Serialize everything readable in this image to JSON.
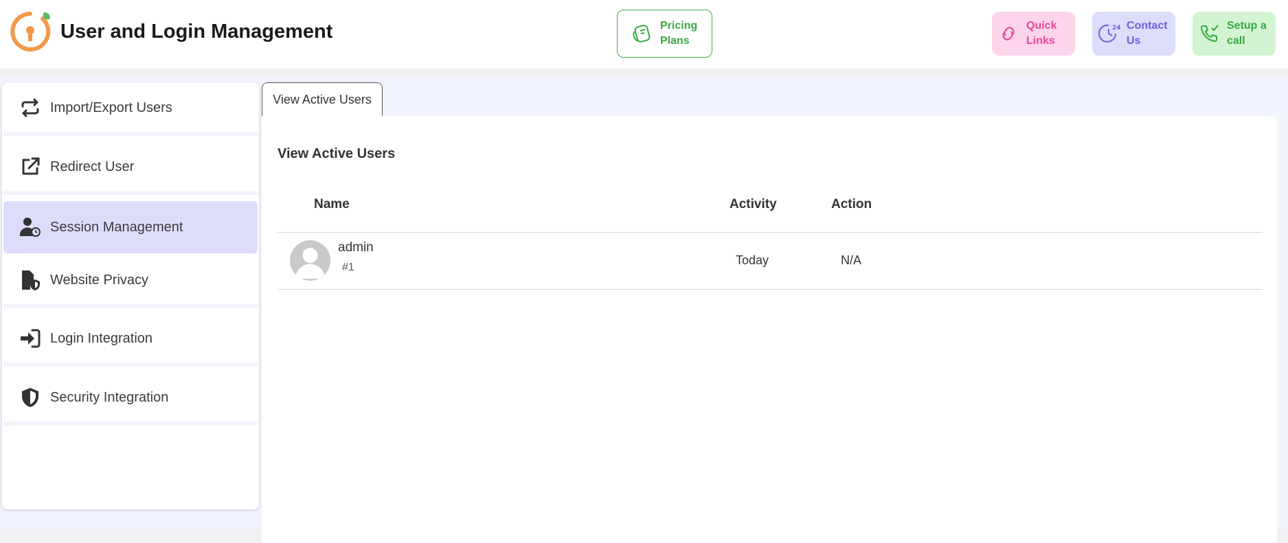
{
  "header": {
    "title": "User and Login Management",
    "buttons": {
      "pricing": "Pricing\nPlans",
      "quick_links": "Quick\nLinks",
      "contact": "Contact\nUs",
      "setup_call": "Setup a\ncall"
    }
  },
  "sidebar": {
    "items": [
      {
        "label": "Import/Export Users",
        "icon": "arrows-swap-icon"
      },
      {
        "label": "Redirect User",
        "icon": "external-link-icon"
      },
      {
        "label": "Session Management",
        "icon": "user-clock-icon",
        "active": true
      },
      {
        "label": "Website Privacy",
        "icon": "file-shield-icon"
      },
      {
        "label": "Login Integration",
        "icon": "sign-in-icon"
      },
      {
        "label": "Security Integration",
        "icon": "shield-icon"
      }
    ]
  },
  "main": {
    "tab_label": "View Active Users",
    "panel_title": "View Active Users",
    "table": {
      "columns": [
        "Name",
        "Activity",
        "Action"
      ],
      "rows": [
        {
          "name": "admin",
          "id": "#1",
          "activity": "Today",
          "action": "N/A"
        }
      ]
    }
  },
  "colors": {
    "accent_orange": "#f2994a",
    "pricing_green": "#37a83f",
    "quick_pink": "#e6469c",
    "contact_purple": "#6b61d9",
    "active_item_bg": "#dedcfb"
  }
}
